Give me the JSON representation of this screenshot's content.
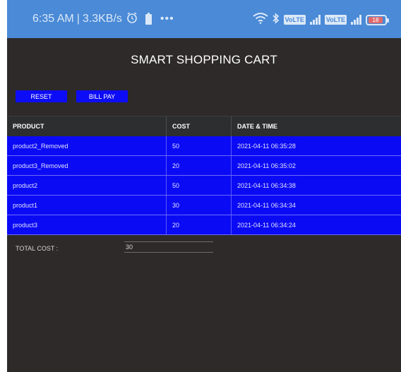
{
  "status_bar": {
    "time": "6:35 AM",
    "separator": "|",
    "speed": "3.3KB/s",
    "more": "•••",
    "sim1_label": "VoLTE",
    "sim2_label": "VoLTE",
    "battery_level": "18",
    "icons": [
      "alarm-icon",
      "battery-small-icon",
      "wifi-icon",
      "bluetooth-icon",
      "signal-icon",
      "battery-icon"
    ]
  },
  "app": {
    "title": "SMART SHOPPING CART"
  },
  "buttons": {
    "reset_label": "RESET",
    "bill_label": "BILL PAY"
  },
  "table": {
    "headers": {
      "product": "PRODUCT",
      "cost": "COST",
      "datetime": "DATE & TIME"
    },
    "rows": [
      {
        "product": "product2_Removed",
        "cost": "50",
        "datetime": "2021-04-11 06:35:28"
      },
      {
        "product": "product3_Removed",
        "cost": "20",
        "datetime": "2021-04-11 06:35:02"
      },
      {
        "product": "product2",
        "cost": "50",
        "datetime": "2021-04-11 06:34:38"
      },
      {
        "product": "product1",
        "cost": "30",
        "datetime": "2021-04-11 06:34:34"
      },
      {
        "product": "product3",
        "cost": "20",
        "datetime": "2021-04-11 06:34:24"
      }
    ]
  },
  "total": {
    "label": "TOTAL COST :",
    "value": "30"
  },
  "colors": {
    "status_bar": "#4a8ad6",
    "background": "#2d2a29",
    "accent_blue": "#0d0cf7"
  }
}
